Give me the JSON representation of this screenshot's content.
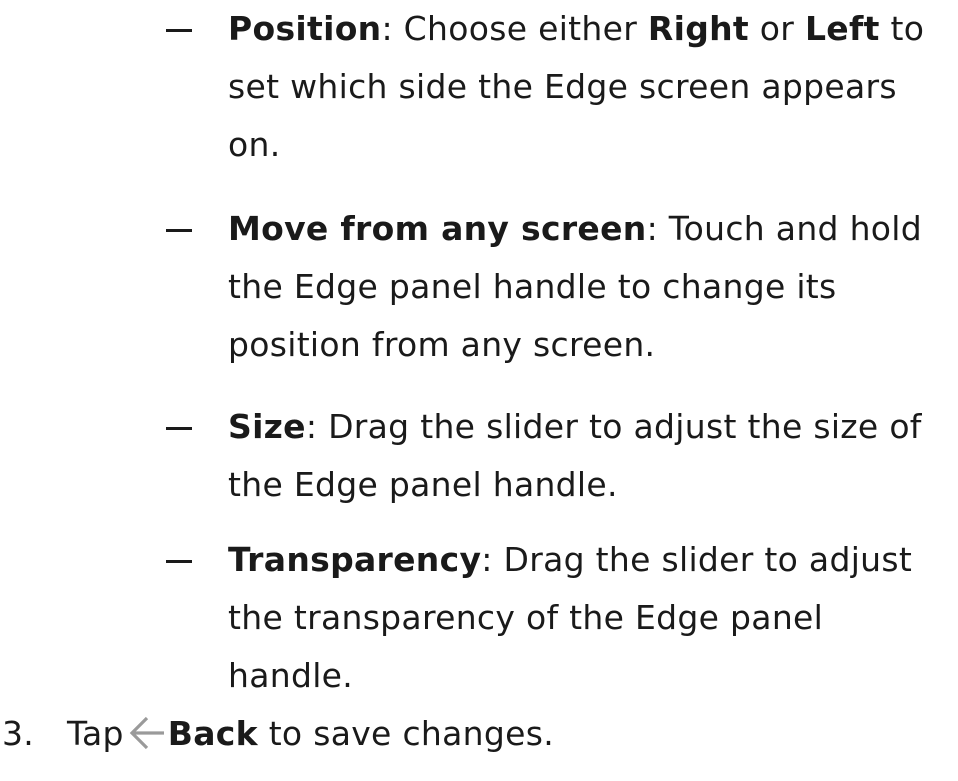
{
  "items": [
    {
      "term": "Position",
      "sep": ":",
      "t1": " Choose either ",
      "b1": "Right",
      "t2": " or ",
      "b2": "Left",
      "t3": " to set which side the Edge screen appears on."
    },
    {
      "term": "Move from any screen",
      "sep": ":",
      "text": " Touch and hold the Edge panel handle to change its position from any screen."
    },
    {
      "term": "Size",
      "sep": ":",
      "text": " Drag the slider to adjust the size of the Edge panel handle."
    },
    {
      "term": "Transparency",
      "sep": ":",
      "text": " Drag the slider to adjust the transparency of the Edge panel handle."
    }
  ],
  "step": {
    "number": "3.",
    "tap": "Tap",
    "icon": "back-arrow-icon",
    "back_label": "Back",
    "rest": " to save changes."
  }
}
